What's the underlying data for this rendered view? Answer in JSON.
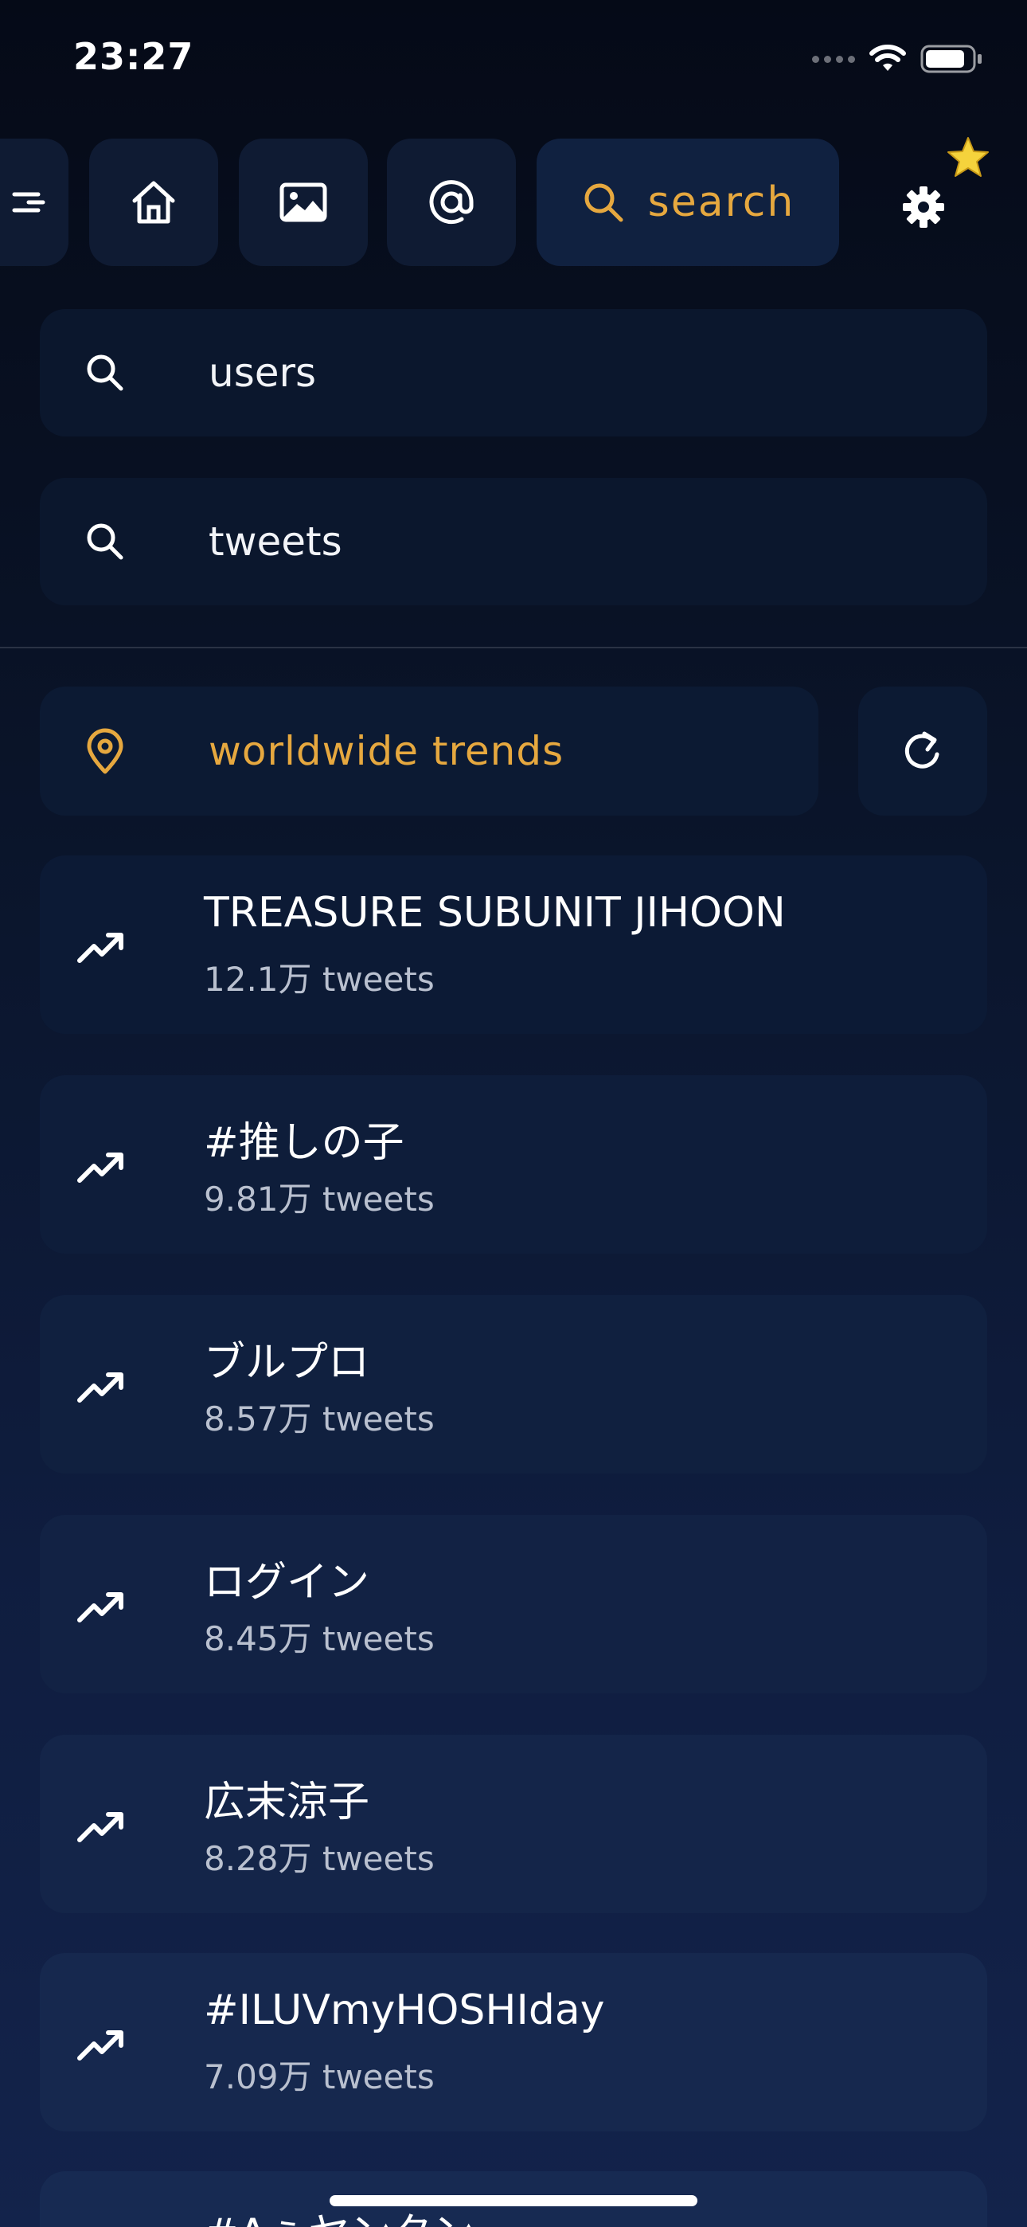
{
  "status": {
    "time": "23:27"
  },
  "toolbar": {
    "search_label": "search",
    "icons": [
      "menu-icon",
      "home-icon",
      "image-icon",
      "at-icon",
      "search-icon",
      "gear-icon",
      "star-icon"
    ]
  },
  "search_options": [
    {
      "label": "users",
      "icon": "search-icon"
    },
    {
      "label": "tweets",
      "icon": "search-icon"
    }
  ],
  "trends": {
    "location_label": "worldwide trends",
    "items": [
      {
        "title": "TREASURE SUBUNIT JIHOON",
        "count": "12.1万 tweets"
      },
      {
        "title": "#推しの子",
        "count": "9.81万 tweets"
      },
      {
        "title": "ブルプロ",
        "count": "8.57万 tweets"
      },
      {
        "title": "ログイン",
        "count": "8.45万 tweets"
      },
      {
        "title": "広末涼子",
        "count": "8.28万 tweets"
      },
      {
        "title": "#ILUVmyHOSHIday",
        "count": "7.09万 tweets"
      },
      {
        "title": "#Aぇヤンタン",
        "count": ""
      }
    ]
  },
  "colors": {
    "accent": "#e6a83f",
    "card": "#0f1b33",
    "background": "#0a1429"
  }
}
